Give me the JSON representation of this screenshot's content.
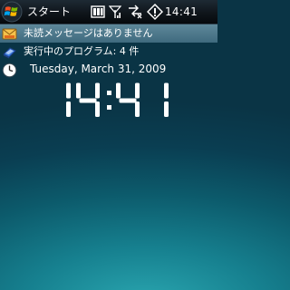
{
  "taskbar": {
    "start_label": "スタート",
    "time": "14:41",
    "icons": [
      "battery-icon",
      "signal-icon",
      "connectivity-icon",
      "notification-icon"
    ]
  },
  "today": {
    "messages": "未読メッセージはありません",
    "programs": "実行中のプログラム: 4 件",
    "date": "Tuesday, March 31, 2009",
    "clock_time": "14:41"
  },
  "colors": {
    "background_top": "#0a3445",
    "background_glow": "#2aa6b0",
    "selected_row": "#4f7a8d"
  }
}
